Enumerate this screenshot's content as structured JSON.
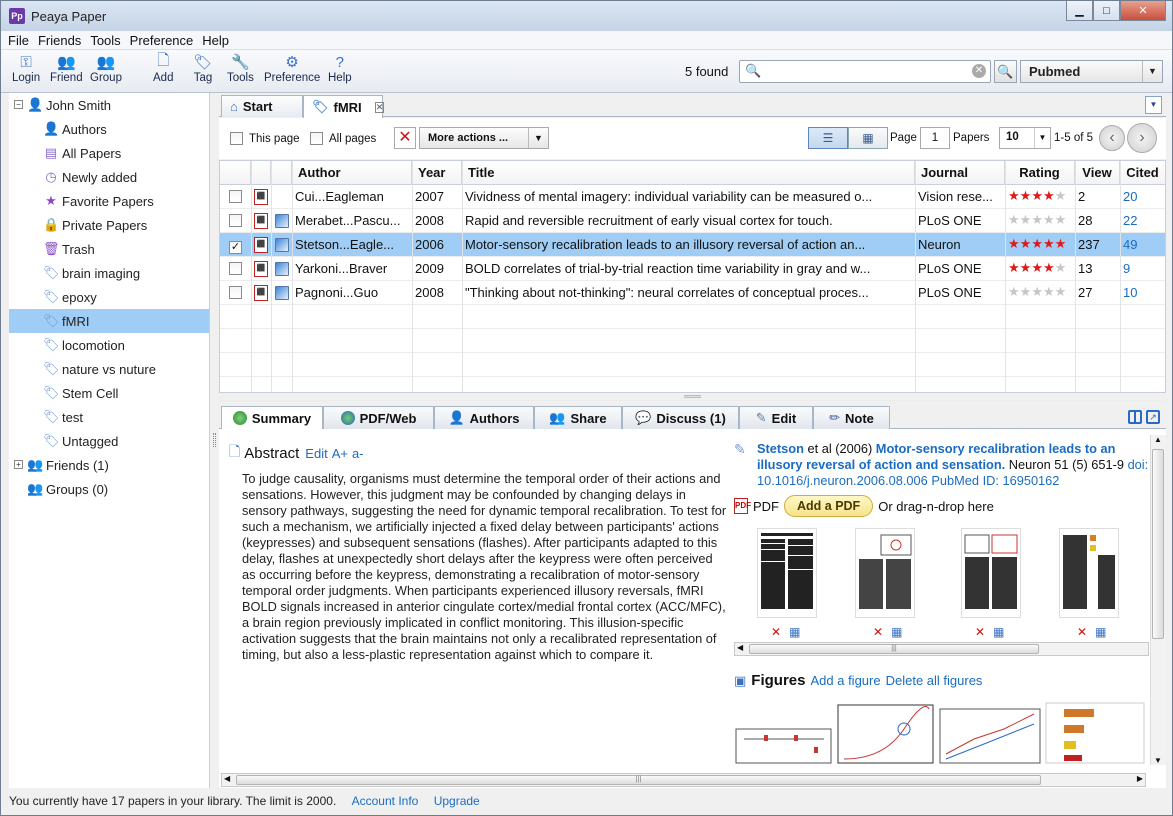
{
  "app": {
    "title": "Peaya Paper",
    "icon_text": "Pp"
  },
  "menu": [
    "File",
    "Friends",
    "Tools",
    "Preference",
    "Help"
  ],
  "toolbar": {
    "buttons": [
      "Login",
      "Friend",
      "Group",
      "Add",
      "Tag",
      "Tools",
      "Preference",
      "Help"
    ],
    "found": "5 found",
    "search_value": "",
    "database": "Pubmed"
  },
  "sidebar": {
    "user": "John Smith",
    "items": [
      "Authors",
      "All Papers",
      "Newly added",
      "Favorite Papers",
      "Private Papers",
      "Trash",
      "brain imaging",
      "epoxy",
      "fMRI",
      "locomotion",
      "nature vs nuture",
      "Stem Cell",
      "test",
      "Untagged"
    ],
    "friends": "Friends (1)",
    "groups": "Groups (0)"
  },
  "tabs": [
    "Start",
    "fMRI"
  ],
  "actions": {
    "this_page": "This page",
    "all_pages": "All pages",
    "more_actions": "More actions ...",
    "page_label": "Page",
    "page_value": "1",
    "papers_label": "Papers",
    "per_page": "10",
    "range": "1-5 of 5"
  },
  "columns": [
    "Author",
    "Year",
    "Title",
    "Journal",
    "Rating",
    "View",
    "Cited"
  ],
  "papers": [
    {
      "author": "Cui...Eagleman",
      "year": "2007",
      "title": "Vividness of mental imagery: individual variability can be measured o...",
      "journal": "Vision rese...",
      "rating": 4,
      "view": "2",
      "cited": "20",
      "checked": false,
      "web": false
    },
    {
      "author": "Merabet...Pascu...",
      "year": "2008",
      "title": "Rapid and reversible recruitment of early visual cortex for touch.",
      "journal": "PLoS ONE",
      "rating": 0,
      "view": "28",
      "cited": "22",
      "checked": false,
      "web": true
    },
    {
      "author": "Stetson...Eagle...",
      "year": "2006",
      "title": "Motor-sensory recalibration leads to an illusory reversal of action an...",
      "journal": "Neuron",
      "rating": 5,
      "view": "237",
      "cited": "49",
      "checked": true,
      "web": true
    },
    {
      "author": "Yarkoni...Braver",
      "year": "2009",
      "title": "BOLD correlates of trial-by-trial reaction time variability in gray and w...",
      "journal": "PLoS ONE",
      "rating": 4,
      "view": "13",
      "cited": "9",
      "checked": false,
      "web": true
    },
    {
      "author": "Pagnoni...Guo",
      "year": "2008",
      "title": "\"Thinking about not-thinking\": neural correlates of conceptual proces...",
      "journal": "PLoS ONE",
      "rating": 0,
      "view": "27",
      "cited": "10",
      "checked": false,
      "web": true
    }
  ],
  "detail_tabs": [
    "Summary",
    "PDF/Web",
    "Authors",
    "Share",
    "Discuss (1)",
    "Edit",
    "Note"
  ],
  "summary": {
    "abstract_label": "Abstract",
    "abstract_links": [
      "Edit",
      "A+",
      "a-"
    ],
    "abstract": "To judge causality, organisms must determine the temporal order of their actions and sensations. However, this judgment may be confounded by changing delays in sensory pathways, suggesting the need for dynamic temporal recalibration. To test for such a mechanism, we artificially injected a fixed delay between participants' actions (keypresses) and subsequent sensations (flashes). After participants adapted to this delay, flashes at unexpectedly short delays after the keypress were often perceived as occurring before the keypress, demonstrating a recalibration of motor-sensory temporal order judgments. When participants experienced illusory reversals, fMRI BOLD signals increased in anterior cingulate cortex/medial frontal cortex (ACC/MFC), a brain region previously implicated in conflict monitoring. This illusion-specific activation suggests that the brain maintains not only a recalibrated representation of timing, but also a less-plastic representation against which to compare it.",
    "ref_author": "Stetson",
    "ref_etal": " et al (2006) ",
    "ref_title": "Motor-sensory recalibration leads to an illusory reversal of action and sensation.",
    "ref_journal": " Neuron 51 (5) 651-9 ",
    "ref_doi": "doi: 10.1016/j.neuron.2006.08.006",
    "ref_pmid": "PubMed ID: 16950162",
    "pdf_label": "PDF",
    "add_pdf": "Add a PDF",
    "drag_text": "Or drag-n-drop here",
    "figures_label": "Figures",
    "add_figure": "Add a figure",
    "delete_figures": "Delete all figures"
  },
  "status": {
    "text": "You currently have 17 papers in your library. The limit is 2000.",
    "account": "Account Info",
    "upgrade": "Upgrade"
  },
  "colors": {
    "selection": "#9fcdf5",
    "link": "#1a6cc2",
    "star": "#e01818"
  }
}
